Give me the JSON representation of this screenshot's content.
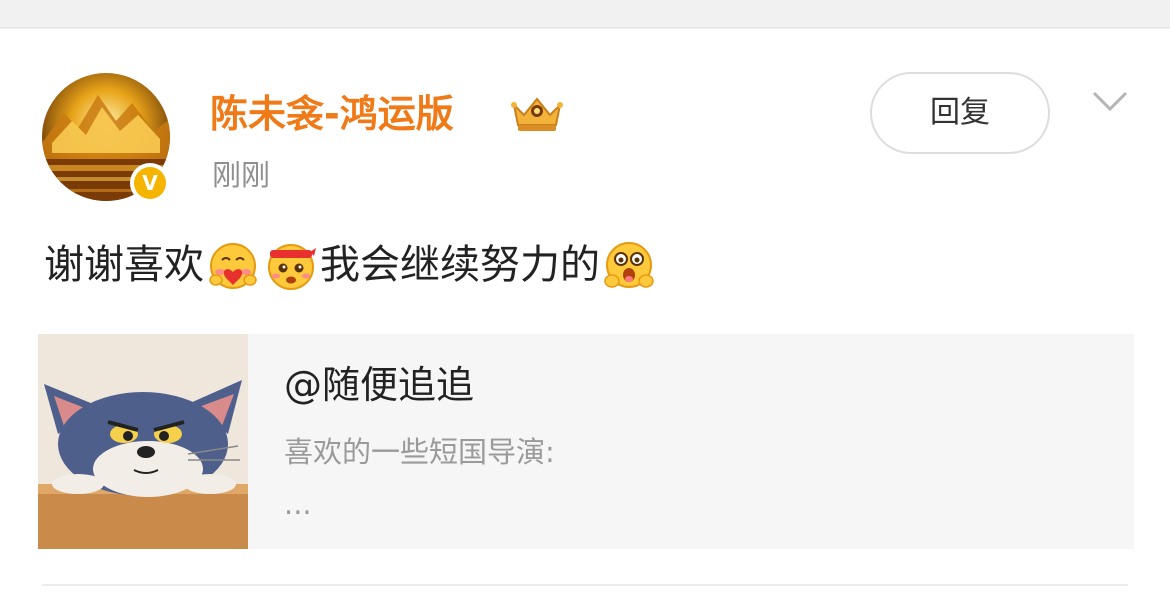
{
  "post": {
    "username": "陈未衾-鸿运版",
    "timestamp": "刚刚",
    "reply_label": "回复",
    "verified_badge": "V",
    "comment": {
      "part1": "谢谢喜欢",
      "emoji1": "hug-heart-emoji",
      "emoji2": "headband-emoji",
      "part2": "我会继续努力的",
      "emoji3": "hug-emoji"
    }
  },
  "quoted": {
    "user": "@随便追追",
    "text": "喜欢的一些短国导演:",
    "more": "..."
  },
  "colors": {
    "username": "#ef7a17",
    "badge": "#f5b400",
    "quote_bg": "#f6f6f6"
  }
}
